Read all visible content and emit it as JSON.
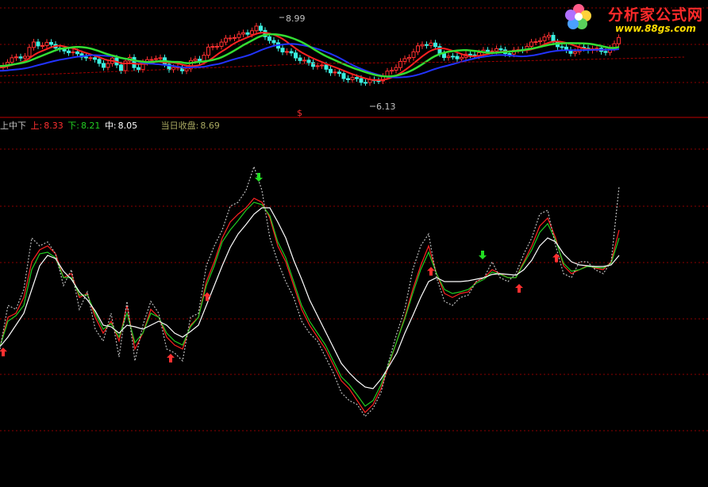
{
  "logo": {
    "name": "分析家公式网",
    "url": "www.88gs.com"
  },
  "legend": {
    "title": "上中下",
    "upper_label": "上:",
    "upper_value": "8.33",
    "lower_label": "下:",
    "lower_value": "8.21",
    "mid_label": "中:",
    "mid_value": "8.05",
    "close_label": "当日收盘:",
    "close_value": "8.69"
  },
  "colors": {
    "background": "#000000",
    "grid": "#8b0000",
    "separator": "#c00000",
    "upper": "#ff2222",
    "lower": "#22cc22",
    "mid": "#ffffff",
    "price": "#bbbbbb",
    "arrow_up": "#ff3030",
    "arrow_down": "#22dd22",
    "text_gray": "#c0c0c0",
    "text_olive": "#a8a860"
  },
  "chart_data": [
    {
      "type": "candlestick",
      "annotations": [
        {
          "label": "8.99",
          "kind": "high"
        },
        {
          "label": "6.13",
          "kind": "low"
        },
        {
          "label": "$",
          "kind": "marker"
        }
      ],
      "ma_colors": [
        "red",
        "blue",
        "lime",
        "darkred"
      ]
    },
    {
      "type": "line",
      "title": "上中下",
      "x": [
        0,
        10,
        20,
        30,
        40,
        50,
        60,
        70,
        80,
        90,
        100,
        110,
        120,
        130,
        140,
        150,
        160,
        170,
        180,
        190,
        200,
        210,
        220,
        230,
        240,
        250,
        260,
        270,
        280,
        290,
        300,
        310,
        320,
        330,
        340,
        350,
        360,
        370,
        380,
        390,
        400,
        410,
        420,
        430,
        440,
        450,
        460,
        470,
        480,
        490,
        500,
        510,
        520,
        530,
        540,
        550,
        560,
        570,
        580,
        590,
        600,
        610,
        620,
        630,
        640,
        650,
        660,
        670,
        680,
        690,
        700,
        710,
        720,
        730,
        740,
        750,
        760,
        770,
        780,
        790,
        800,
        810,
        820,
        830,
        840,
        850,
        860
      ],
      "series": [
        {
          "name": "上",
          "color": "red",
          "values": [
            437,
            400,
            395,
            375,
            330,
            315,
            310,
            320,
            350,
            345,
            375,
            370,
            400,
            420,
            405,
            430,
            385,
            440,
            420,
            390,
            400,
            425,
            435,
            440,
            410,
            400,
            355,
            330,
            300,
            280,
            270,
            262,
            250,
            255,
            275,
            310,
            330,
            360,
            390,
            410,
            425,
            440,
            460,
            480,
            490,
            505,
            520,
            510,
            490,
            460,
            430,
            400,
            365,
            335,
            310,
            345,
            370,
            375,
            370,
            368,
            355,
            350,
            340,
            345,
            350,
            350,
            330,
            310,
            285,
            275,
            300,
            335,
            345,
            340,
            335,
            338,
            340,
            330,
            290
          ]
        },
        {
          "name": "下",
          "color": "green",
          "values": [
            437,
            405,
            398,
            385,
            340,
            320,
            318,
            325,
            350,
            350,
            372,
            372,
            395,
            415,
            408,
            425,
            395,
            432,
            420,
            395,
            400,
            420,
            430,
            435,
            412,
            400,
            360,
            335,
            305,
            290,
            278,
            265,
            255,
            258,
            272,
            305,
            325,
            355,
            385,
            405,
            420,
            435,
            455,
            475,
            485,
            498,
            512,
            505,
            485,
            458,
            430,
            402,
            370,
            340,
            318,
            345,
            365,
            370,
            368,
            365,
            357,
            352,
            343,
            346,
            350,
            350,
            332,
            315,
            293,
            282,
            303,
            332,
            342,
            340,
            336,
            337,
            338,
            332,
            300
          ]
        },
        {
          "name": "中",
          "color": "white",
          "values": [
            437,
            425,
            410,
            395,
            365,
            335,
            322,
            326,
            342,
            352,
            368,
            378,
            392,
            410,
            412,
            420,
            410,
            412,
            415,
            410,
            405,
            410,
            420,
            425,
            418,
            410,
            385,
            360,
            335,
            312,
            295,
            283,
            270,
            262,
            262,
            280,
            300,
            328,
            352,
            378,
            398,
            418,
            438,
            458,
            470,
            480,
            488,
            490,
            478,
            462,
            445,
            420,
            398,
            375,
            355,
            350,
            355,
            355,
            355,
            354,
            352,
            350,
            346,
            345,
            346,
            347,
            340,
            328,
            310,
            300,
            305,
            320,
            330,
            334,
            335,
            336,
            336,
            334,
            322
          ]
        },
        {
          "name": "收盘",
          "color": "gray",
          "dashed": true,
          "values": [
            440,
            385,
            390,
            365,
            300,
            310,
            305,
            320,
            360,
            340,
            390,
            368,
            415,
            430,
            395,
            450,
            380,
            455,
            410,
            380,
            395,
            440,
            445,
            455,
            400,
            395,
            335,
            310,
            290,
            260,
            255,
            240,
            210,
            240,
            300,
            330,
            355,
            375,
            405,
            420,
            430,
            450,
            470,
            495,
            505,
            510,
            525,
            515,
            495,
            455,
            420,
            390,
            340,
            310,
            295,
            350,
            380,
            385,
            375,
            372,
            355,
            350,
            330,
            350,
            355,
            345,
            320,
            300,
            270,
            265,
            310,
            345,
            350,
            330,
            330,
            340,
            345,
            330,
            235
          ]
        }
      ],
      "signals": [
        {
          "dir": "up",
          "x": 4
        },
        {
          "dir": "up",
          "x": 215
        },
        {
          "dir": "up",
          "x": 261
        },
        {
          "dir": "down",
          "x": 326
        },
        {
          "dir": "up",
          "x": 543
        },
        {
          "dir": "down",
          "x": 608
        },
        {
          "dir": "up",
          "x": 654
        },
        {
          "dir": "up",
          "x": 701
        },
        {
          "dir": "up",
          "x": 850
        }
      ]
    }
  ]
}
